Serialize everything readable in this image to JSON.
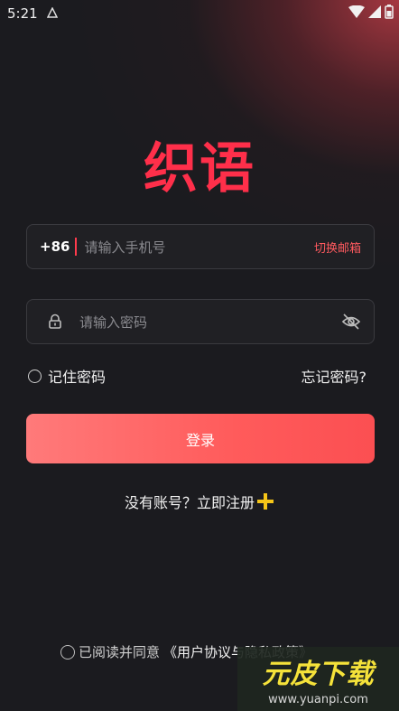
{
  "status_bar": {
    "time": "5:21"
  },
  "app": {
    "logo_text": "织语"
  },
  "phone": {
    "prefix": "+86",
    "placeholder": "请输入手机号",
    "switch_label": "切换邮箱"
  },
  "password": {
    "placeholder": "请输入密码"
  },
  "remember": {
    "label": "记住密码"
  },
  "forgot": {
    "label": "忘记密码?"
  },
  "login": {
    "label": "登录"
  },
  "register": {
    "label": "没有账号？立即注册"
  },
  "agreement": {
    "prefix": "已阅读并同意",
    "policy": "《用户协议与隐私政策》"
  },
  "watermark": {
    "title": "元皮下载",
    "url": "www.yuanpi.com"
  },
  "colors": {
    "brand": "#ff2f4a",
    "button": "#ff5b5b",
    "accent_text": "#ff5a5f",
    "background": "#1b1b1f"
  }
}
